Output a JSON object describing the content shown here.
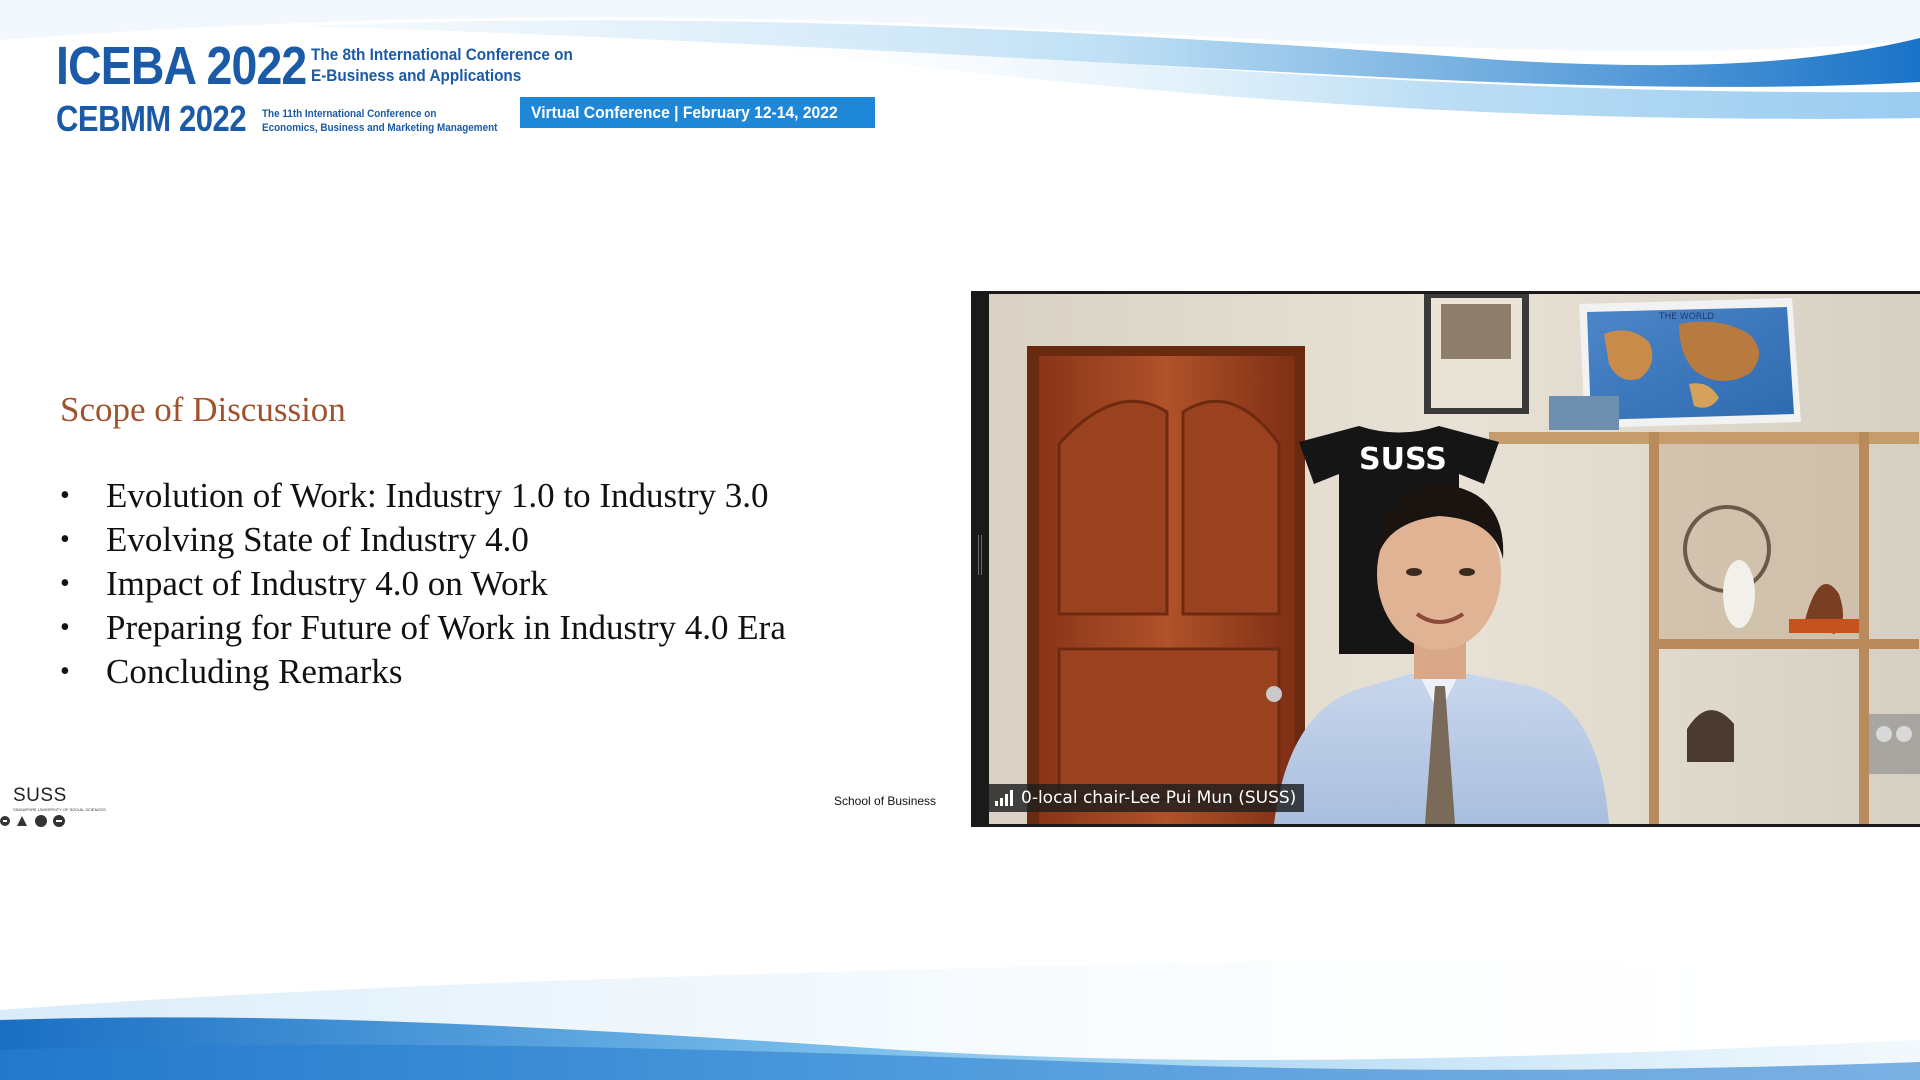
{
  "header": {
    "iceba_title": "ICEBA 2022",
    "iceba_subtitle_line1": "The 8th International Conference on",
    "iceba_subtitle_line2": "E-Business and Applications",
    "cebmm_title": "CEBMM 2022",
    "cebmm_subtitle_line1": "The 11th International Conference on",
    "cebmm_subtitle_line2": "Economics, Business and Marketing Management",
    "banner": "Virtual Conference | February 12-14, 2022"
  },
  "slide": {
    "title": "Scope of Discussion",
    "bullets": [
      "Evolution of Work: Industry 1.0 to Industry 3.0",
      "Evolving State of Industry 4.0",
      "Impact of Industry 4.0 on Work",
      "Preparing for Future of Work in Industry 4.0 Era",
      "Concluding Remarks"
    ],
    "logo_text": "SUSS",
    "logo_tagline": "SINGAPORE UNIVERSITY OF SOCIAL SCIENCES",
    "footer_label": "School of Business"
  },
  "video": {
    "participant_name": "0-local chair-Lee Pui Mun (SUSS)",
    "shirt_text": "SUSS",
    "map_text": "THE WORLD"
  },
  "colors": {
    "brand_blue": "#1b5aa6",
    "banner_blue": "#1f87d8",
    "title_brown": "#a0522d"
  },
  "icons": {
    "signal": "signal-strength-icon",
    "resize": "resize-handle-icon"
  }
}
